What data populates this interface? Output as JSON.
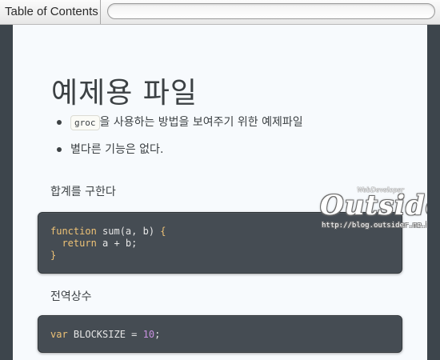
{
  "toolbar": {
    "toc_label": "Table of Contents",
    "search_value": "",
    "search_placeholder": ""
  },
  "document": {
    "title": "예제용 파일",
    "bullets": [
      {
        "code": "groc",
        "text": "을 사용하는 방법을 보여주기 위한 예제파일"
      },
      {
        "code": "",
        "text": "별다른 기능은 없다."
      }
    ],
    "sections": [
      {
        "heading": "합계를 구한다",
        "code_lines": [
          "function sum(a, b) {",
          "  return a + b;",
          "}"
        ]
      },
      {
        "heading": "전역상수",
        "code_lines": [
          "var BLOCKSIZE = 10;"
        ]
      }
    ]
  },
  "watermark": {
    "tagline": "WebDeveloper",
    "name": "Outsider",
    "url": "http://blog.outsider.ne.kr"
  },
  "colors": {
    "page_background": "#3d454c",
    "document_background": "#f7fafd",
    "code_background": "#454c53",
    "keyword": "#eec276",
    "number": "#c991e1"
  }
}
